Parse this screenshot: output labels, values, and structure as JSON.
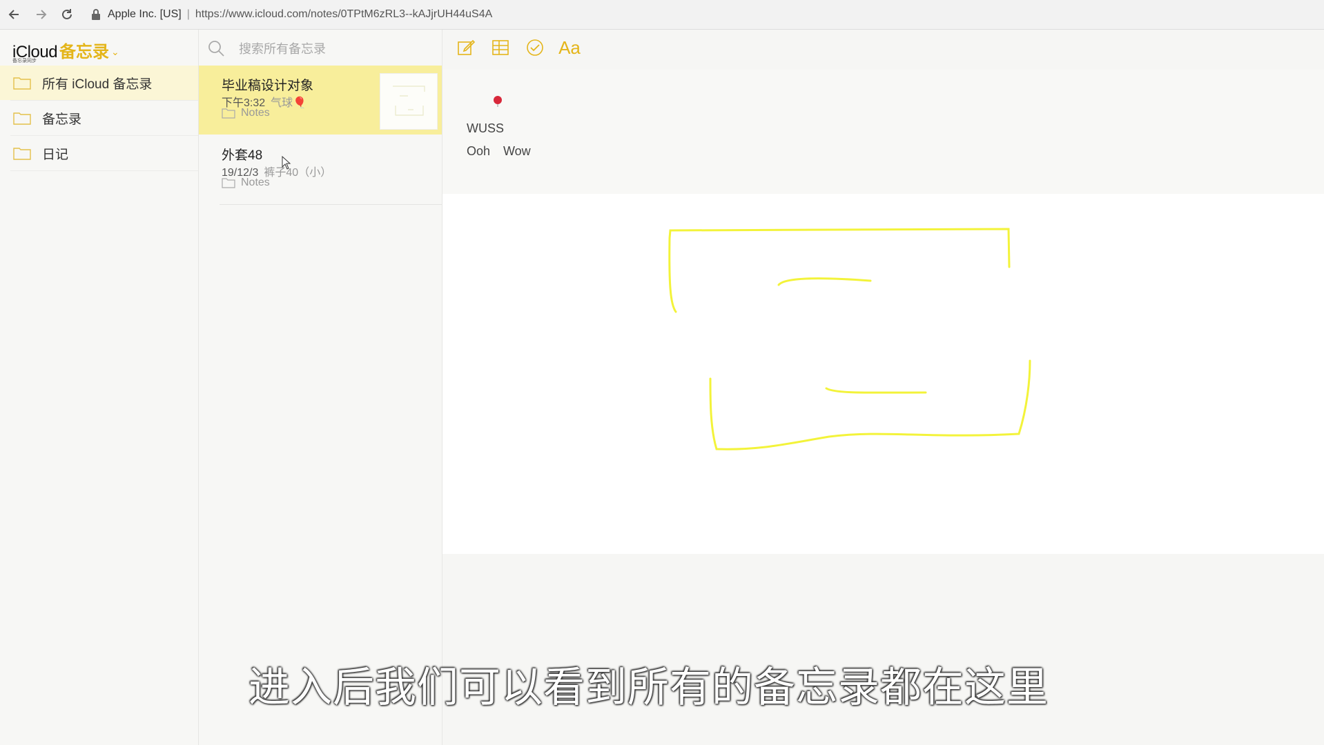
{
  "browser": {
    "site_identity": "Apple Inc. [US]",
    "url": "https://www.icloud.com/notes/0TPtM6zRL3--kAJjrUH44uS4A"
  },
  "brand": {
    "icloud": "iCloud",
    "app": "备忘录",
    "sub": "备忘录同步"
  },
  "folders": [
    {
      "label": "所有 iCloud 备忘录"
    },
    {
      "label": "备忘录"
    },
    {
      "label": "日记"
    }
  ],
  "search": {
    "placeholder": "搜索所有备忘录"
  },
  "notes": [
    {
      "title": "毕业稿设计对象",
      "time": "下午3:32",
      "preview": "气球🎈",
      "folder": "Notes"
    },
    {
      "title": "外套48",
      "time": "19/12/3",
      "preview": "裤子40（小）",
      "folder": "Notes"
    }
  ],
  "toolbar": {
    "format_label": "Aa"
  },
  "editor": {
    "line1": "WUSS",
    "line2a": "Ooh",
    "line2b": "Wow"
  },
  "subtitle": "进入后我们可以看到所有的备忘录都在这里",
  "colors": {
    "accent": "#e4b51a",
    "selected_note": "#f8ee9b",
    "sketch": "#f3f33a"
  }
}
